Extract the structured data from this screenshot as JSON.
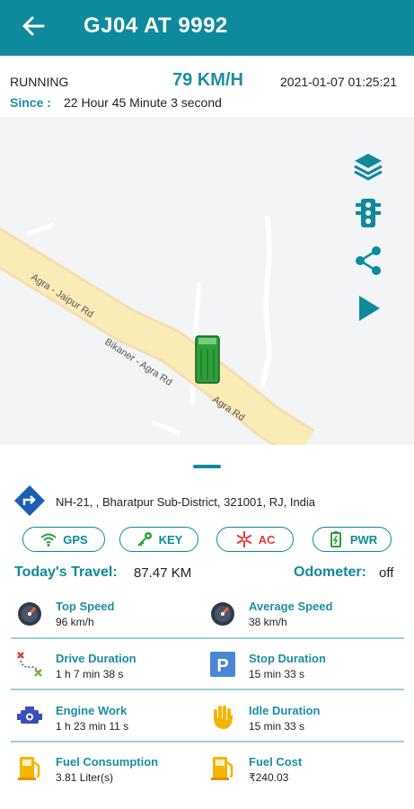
{
  "appbar": {
    "title": "GJ04 AT 9992"
  },
  "status": {
    "state": "RUNNING",
    "speed": "79 KM/H",
    "datetime": "2021-01-07 01:25:21",
    "since_label": "Since :",
    "since_value": "22 Hour 45 Minute 3 second"
  },
  "map": {
    "roads": [
      "Agra - Jaipur Rd",
      "Bikaner - Agra Rd",
      "Agra Rd"
    ],
    "tools": [
      "layers-icon",
      "traffic-light-icon",
      "share-icon",
      "play-icon"
    ]
  },
  "address": "NH-21, , Bharatpur Sub-District, 321001, RJ, India",
  "indicators": [
    {
      "label": "GPS",
      "icon": "wifi-icon"
    },
    {
      "label": "KEY",
      "icon": "key-icon"
    },
    {
      "label": "AC",
      "icon": "snowflake-icon"
    },
    {
      "label": "PWR",
      "icon": "battery-icon"
    }
  ],
  "travel": {
    "label": "Today's Travel:",
    "value": "87.47 KM"
  },
  "odometer": {
    "label": "Odometer:",
    "value": "off"
  },
  "stats": [
    {
      "label": "Top Speed",
      "value": "96 km/h",
      "icon": "speedometer-icon"
    },
    {
      "label": "Average Speed",
      "value": "38 km/h",
      "icon": "speedometer-icon"
    },
    {
      "label": "Drive Duration",
      "value": "1 h 7 min 38 s",
      "icon": "route-icon"
    },
    {
      "label": "Stop Duration",
      "value": "15 min 33 s",
      "icon": "parking-icon"
    },
    {
      "label": "Engine Work",
      "value": "1 h 23 min 11 s",
      "icon": "engine-icon"
    },
    {
      "label": "Idle Duration",
      "value": "15 min 33 s",
      "icon": "hand-icon"
    },
    {
      "label": "Fuel Consumption",
      "value": "3.81 Liter(s)",
      "icon": "fuel-pump-icon"
    },
    {
      "label": "Fuel Cost",
      "value": "₹240.03",
      "icon": "fuel-pump-icon"
    }
  ],
  "colors": {
    "primary": "#0e8a9c",
    "road": "#f7e7a8",
    "vehicle": "#2e9e3a"
  }
}
